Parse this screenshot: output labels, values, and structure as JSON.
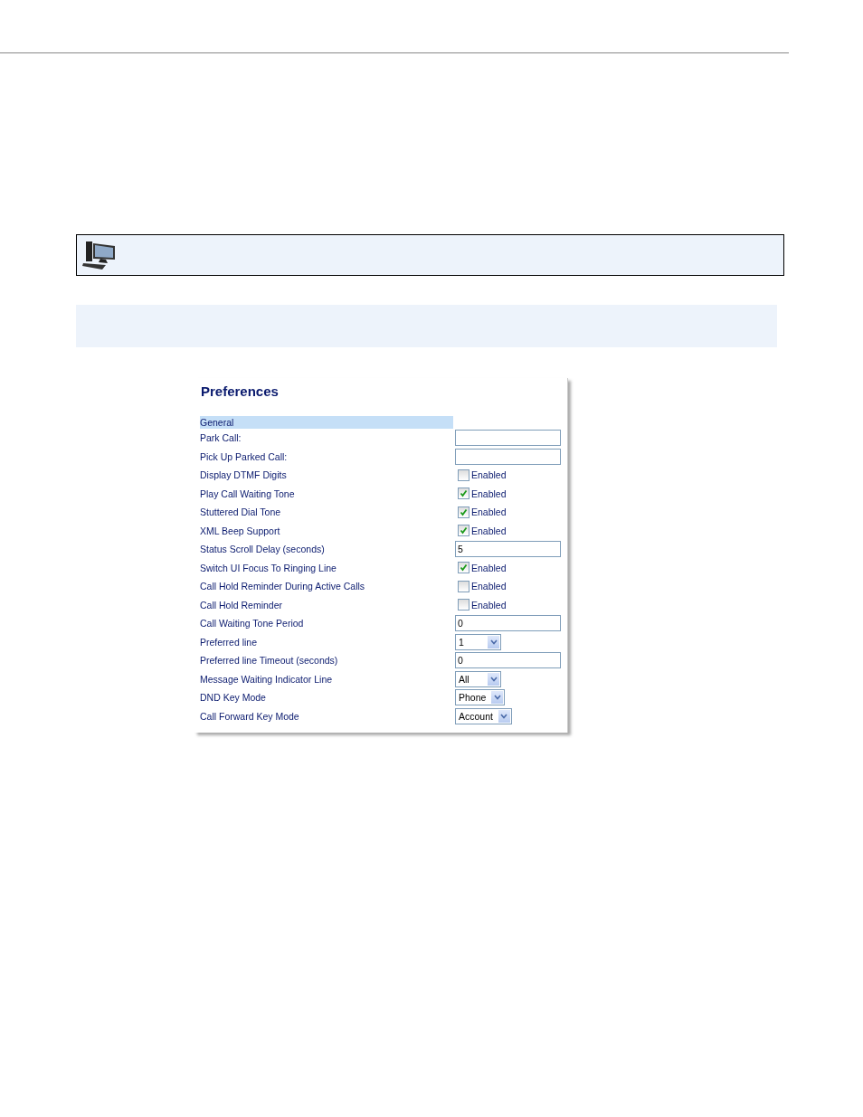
{
  "panel": {
    "title": "Preferences",
    "section": "General",
    "rows": [
      {
        "label": "Park Call:",
        "kind": "text",
        "value": ""
      },
      {
        "label": "Pick Up Parked Call:",
        "kind": "text",
        "value": ""
      },
      {
        "label": "Display DTMF Digits",
        "kind": "checkbox",
        "checked": false,
        "option": "Enabled"
      },
      {
        "label": "Play Call Waiting Tone",
        "kind": "checkbox",
        "checked": true,
        "option": "Enabled"
      },
      {
        "label": "Stuttered Dial Tone",
        "kind": "checkbox",
        "checked": true,
        "option": "Enabled"
      },
      {
        "label": "XML Beep Support",
        "kind": "checkbox",
        "checked": true,
        "option": "Enabled"
      },
      {
        "label": "Status Scroll Delay (seconds)",
        "kind": "text",
        "value": "5"
      },
      {
        "label": "Switch UI Focus To Ringing Line",
        "kind": "checkbox",
        "checked": true,
        "option": "Enabled"
      },
      {
        "label": "Call Hold Reminder During Active Calls",
        "kind": "checkbox",
        "checked": false,
        "option": "Enabled"
      },
      {
        "label": "Call Hold Reminder",
        "kind": "checkbox",
        "checked": false,
        "option": "Enabled"
      },
      {
        "label": "Call Waiting Tone Period",
        "kind": "text",
        "value": "0"
      },
      {
        "label": "Preferred line",
        "kind": "select",
        "value": "1"
      },
      {
        "label": "Preferred line Timeout (seconds)",
        "kind": "text",
        "value": "0"
      },
      {
        "label": "Message Waiting Indicator Line",
        "kind": "select",
        "value": "All"
      },
      {
        "label": "DND Key Mode",
        "kind": "select",
        "value": "Phone"
      },
      {
        "label": "Call Forward Key Mode",
        "kind": "select",
        "value": "Account"
      }
    ]
  }
}
